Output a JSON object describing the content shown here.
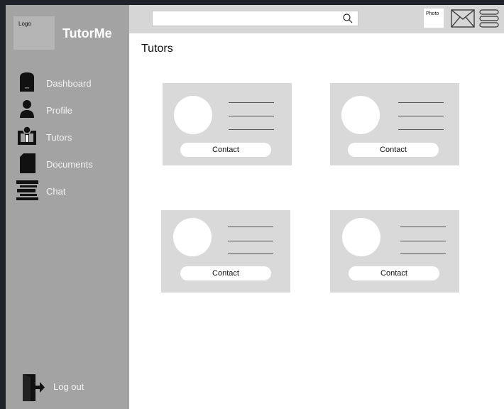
{
  "sidebar": {
    "logo_label": "Logo",
    "brand": "TutorMe",
    "items": [
      {
        "label": "Dashboard",
        "icon": "dashboard-icon"
      },
      {
        "label": "Profile",
        "icon": "profile-icon"
      },
      {
        "label": "Tutors",
        "icon": "tutors-icon"
      },
      {
        "label": "Documents",
        "icon": "documents-icon"
      },
      {
        "label": "Chat",
        "icon": "chat-icon"
      }
    ],
    "logout_label": "Log out"
  },
  "topbar": {
    "search_value": "",
    "photo_label": "Photo"
  },
  "main": {
    "title": "Tutors",
    "cards": [
      {
        "contact_label": "Contact"
      },
      {
        "contact_label": "Contact"
      },
      {
        "contact_label": "Contact"
      },
      {
        "contact_label": "Contact"
      }
    ]
  }
}
